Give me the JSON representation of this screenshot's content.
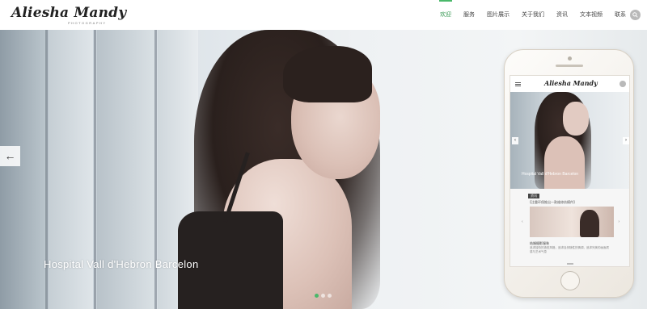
{
  "header": {
    "logo_text": "Aliesha Mandy",
    "logo_sub": "PHOTOGRAPHY",
    "nav": [
      {
        "label": "欢迎",
        "active": true
      },
      {
        "label": "服务",
        "active": false
      },
      {
        "label": "图片展示",
        "active": false
      },
      {
        "label": "关于我们",
        "active": false
      },
      {
        "label": "资讯",
        "active": false
      },
      {
        "label": "文本视频",
        "active": false
      },
      {
        "label": "联系",
        "active": false
      }
    ],
    "search_icon": "search-icon",
    "accent_color": "#4ab86a"
  },
  "hero": {
    "caption": "Hospital Vall d'Hebron Barcelon",
    "prev_arrow": "←",
    "slide_count": 3,
    "active_slide": 1
  },
  "phone": {
    "logo_text": "Aliesha Mandy",
    "hero_caption": "Hospital Vall d'Hebron Barcelon",
    "news_tag": "资讯",
    "news_title": "【注重环保推出一款维修纺模件】",
    "news_heading": "结婚摄影服装",
    "news_text": "追求独特的造型风格，追求自然随性的情调，追求完美的画面质感与艺术气息"
  }
}
